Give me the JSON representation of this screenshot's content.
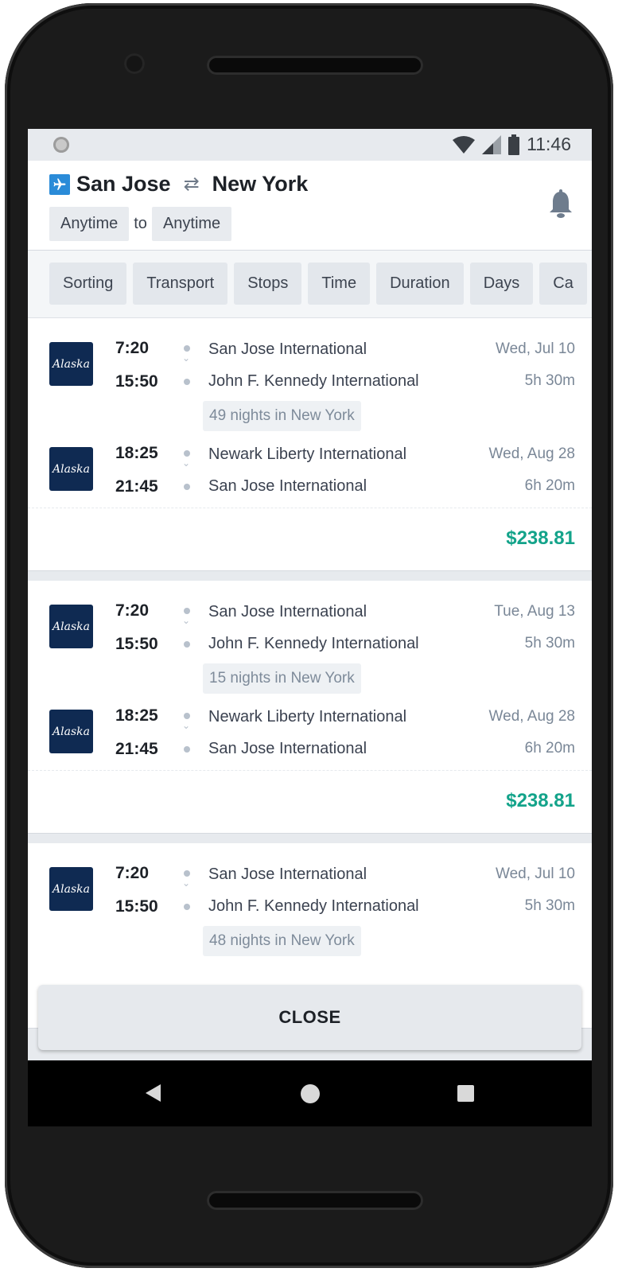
{
  "status": {
    "time": "11:46"
  },
  "header": {
    "origin": "San Jose",
    "destination": "New York",
    "date_from": "Anytime",
    "to_label": "to",
    "date_to": "Anytime"
  },
  "filters": [
    "Sorting",
    "Transport",
    "Stops",
    "Time",
    "Duration",
    "Days",
    "Ca"
  ],
  "results": [
    {
      "outbound": {
        "airline": "Alaska",
        "dep_time": "7:20",
        "arr_time": "15:50",
        "dep_airport": "San Jose International",
        "arr_airport": "John F. Kennedy International",
        "date": "Wed, Jul 10",
        "duration": "5h 30m"
      },
      "stay": "49 nights in New York",
      "inbound": {
        "airline": "Alaska",
        "dep_time": "18:25",
        "arr_time": "21:45",
        "dep_airport": "Newark Liberty International",
        "arr_airport": "San Jose International",
        "date": "Wed, Aug 28",
        "duration": "6h 20m"
      },
      "price": "$238.81"
    },
    {
      "outbound": {
        "airline": "Alaska",
        "dep_time": "7:20",
        "arr_time": "15:50",
        "dep_airport": "San Jose International",
        "arr_airport": "John F. Kennedy International",
        "date": "Tue, Aug 13",
        "duration": "5h 30m"
      },
      "stay": "15 nights in New York",
      "inbound": {
        "airline": "Alaska",
        "dep_time": "18:25",
        "arr_time": "21:45",
        "dep_airport": "Newark Liberty International",
        "arr_airport": "San Jose International",
        "date": "Wed, Aug 28",
        "duration": "6h 20m"
      },
      "price": "$238.81"
    },
    {
      "outbound": {
        "airline": "Alaska",
        "dep_time": "7:20",
        "arr_time": "15:50",
        "dep_airport": "San Jose International",
        "arr_airport": "John F. Kennedy International",
        "date": "Wed, Jul 10",
        "duration": "5h 30m"
      },
      "stay": "48 nights in New York"
    }
  ],
  "close_label": "CLOSE",
  "colors": {
    "accent": "#13a38a",
    "airline": "#0f2a52"
  }
}
